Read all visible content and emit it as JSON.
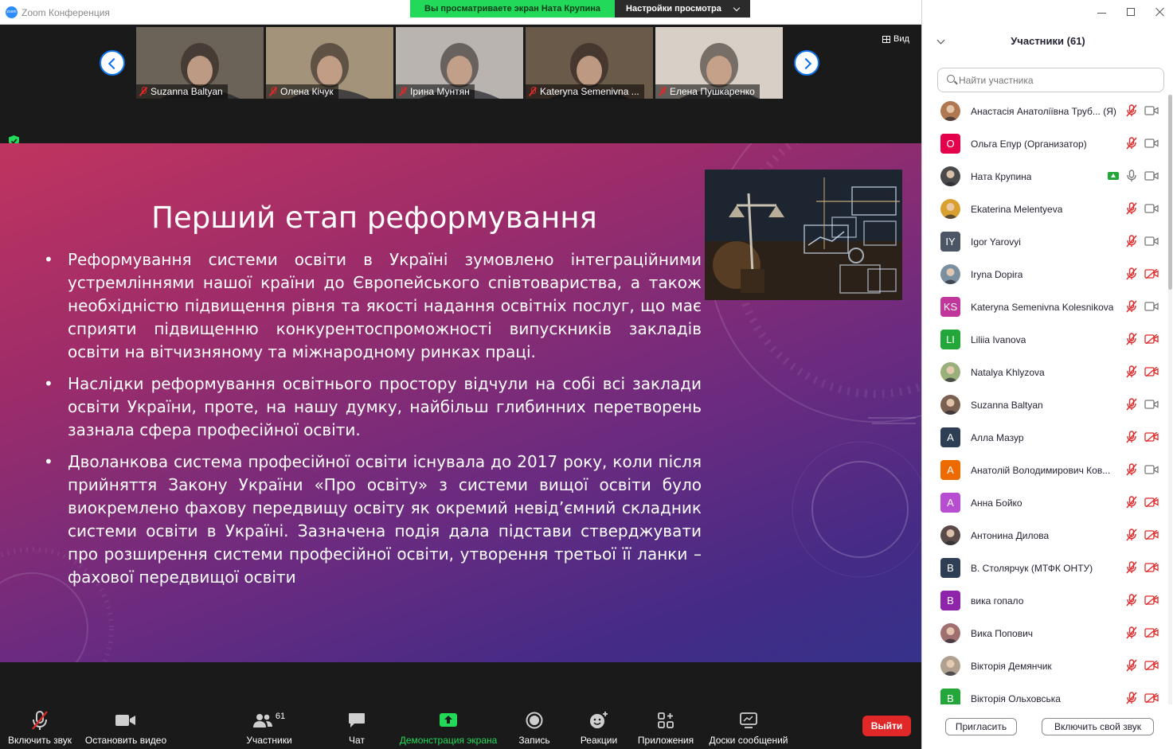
{
  "window": {
    "title": "Zoom Конференция"
  },
  "share_banner": {
    "viewing": "Вы просматриваете экран Ната Крупина",
    "view_settings": "Настройки просмотра"
  },
  "view_button": "Вид",
  "thumbnails": [
    {
      "name": "Suzanna Baltyan",
      "bg": "#6b6258"
    },
    {
      "name": "Олена Кічук",
      "bg": "#a2937a"
    },
    {
      "name": "Ірина Мунтян",
      "bg": "#b9b4b0"
    },
    {
      "name": "Kateryna Semenivna ...",
      "bg": "#6a5a4a"
    },
    {
      "name": "Елена Пушкаренко",
      "bg": "#d8d0c6"
    }
  ],
  "slide": {
    "title": "Перший етап реформування",
    "bullets": [
      "Реформування системи освіти в Україні зумовлено інтеграційними устремліннями нашої країни до Європейського співтовариства, а також необхідністю підвищення рівня та якості надання освітніх послуг, що має сприяти підвищенню конкурентоспроможності випускників закладів освіти на вітчизняному та міжнародному ринках праці.",
      "Наслідки реформування освітнього простору відчули на собі всі заклади освіти України, проте, на нашу думку, найбільш глибинних перетворень зазнала сфера професійної освіти.",
      "Дволанкова система професійної освіти існувала до 2017 року, коли після прийняття Закону України «Про освіту» з системи вищої освіти було виокремлено фахову передвищу освіту як окремий невід’ємний складник системи освіти в Україні. Зазначена подія дала підстави стверджувати про розширення системи професійної освіти, утворення третьої її ланки – фахової передвищої освіти"
    ]
  },
  "toolbar": {
    "unmute": "Включить звук",
    "stop_video": "Остановить видео",
    "participants": "Участники",
    "participants_count": "61",
    "chat": "Чат",
    "share_screen": "Демонстрация экрана",
    "record": "Запись",
    "reactions": "Реакции",
    "apps": "Приложения",
    "whiteboards": "Доски сообщений",
    "leave": "Выйти"
  },
  "panel": {
    "title": "Участники (61)",
    "search_placeholder": "Найти участника",
    "invite": "Пригласить",
    "unmute_self": "Включить свой звук",
    "participants": [
      {
        "name": "Анастасія Анатоліївна Труб... (Я)",
        "avatar": "photo",
        "color": "#b07850",
        "mic": "off",
        "cam": "on"
      },
      {
        "name": "Ольга Епур (Организатор)",
        "avatar": "О",
        "color": "#e5004b",
        "mic": "off",
        "cam": "on"
      },
      {
        "name": "Ната Крупина",
        "avatar": "photo",
        "color": "#4a4a4a",
        "mic": "on",
        "cam": "on",
        "sharing": true
      },
      {
        "name": "Ekaterina Melentyeva",
        "avatar": "photo",
        "color": "#d9a030",
        "mic": "off",
        "cam": "on"
      },
      {
        "name": "Igor Yarovyi",
        "avatar": "IY",
        "color": "#4c5566",
        "mic": "off",
        "cam": "on"
      },
      {
        "name": "Iryna Dopira",
        "avatar": "photo",
        "color": "#7a8fa0",
        "mic": "off",
        "cam": "off"
      },
      {
        "name": "Kateryna Semenivna Kolesnikova",
        "avatar": "KS",
        "color": "#c1369b",
        "mic": "off",
        "cam": "on"
      },
      {
        "name": "Liliia Ivanova",
        "avatar": "LI",
        "color": "#23a63a",
        "mic": "off",
        "cam": "off"
      },
      {
        "name": "Natalya Khlyzova",
        "avatar": "photo",
        "color": "#9ab07a",
        "mic": "off",
        "cam": "off"
      },
      {
        "name": "Suzanna Baltyan",
        "avatar": "photo",
        "color": "#7a6050",
        "mic": "off",
        "cam": "on"
      },
      {
        "name": "Алла Мазур",
        "avatar": "А",
        "color": "#2e3f55",
        "mic": "off",
        "cam": "off"
      },
      {
        "name": "Анатолій Володимирович Ков...",
        "avatar": "А",
        "color": "#ec6a00",
        "mic": "off",
        "cam": "on"
      },
      {
        "name": "Анна Бойко",
        "avatar": "А",
        "color": "#b74ed1",
        "mic": "off",
        "cam": "off"
      },
      {
        "name": "Антонина Дилова",
        "avatar": "photo",
        "color": "#5a4a48",
        "mic": "off",
        "cam": "off"
      },
      {
        "name": "В. Столярчук (МТФК ОНТУ)",
        "avatar": "В",
        "color": "#2e3f55",
        "mic": "off",
        "cam": "off"
      },
      {
        "name": "вика гопало",
        "avatar": "В",
        "color": "#8e24aa",
        "mic": "off",
        "cam": "off"
      },
      {
        "name": "Вика Попович",
        "avatar": "photo",
        "color": "#a07070",
        "mic": "off",
        "cam": "off"
      },
      {
        "name": "Вікторія Демянчик",
        "avatar": "photo",
        "color": "#b0a090",
        "mic": "off",
        "cam": "off"
      },
      {
        "name": "Вікторія Ольховська",
        "avatar": "В",
        "color": "#23a63a",
        "mic": "off",
        "cam": "off"
      }
    ]
  }
}
